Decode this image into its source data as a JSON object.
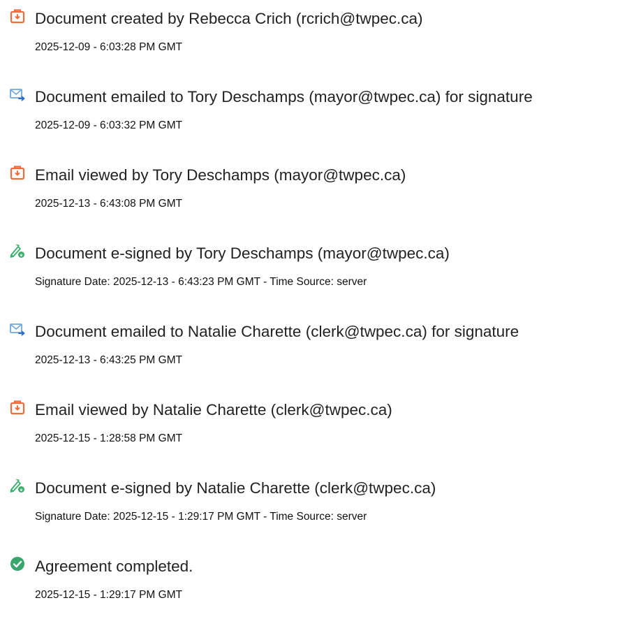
{
  "events": [
    {
      "icon": "document-created-icon",
      "title": "Document created by Rebecca Crich (rcrich@twpec.ca)",
      "detail": "2025-12-09 - 6:03:28 PM GMT"
    },
    {
      "icon": "email-sent-icon",
      "title": "Document emailed to Tory Deschamps (mayor@twpec.ca) for signature",
      "detail": "2025-12-09 - 6:03:32 PM GMT"
    },
    {
      "icon": "email-viewed-icon",
      "title": "Email viewed by Tory Deschamps (mayor@twpec.ca)",
      "detail": "2025-12-13 - 6:43:08 PM GMT"
    },
    {
      "icon": "esign-pen-icon",
      "title": "Document e-signed by Tory Deschamps (mayor@twpec.ca)",
      "detail": "Signature Date: 2025-12-13 - 6:43:23 PM GMT - Time Source: server"
    },
    {
      "icon": "email-sent-icon",
      "title": "Document emailed to Natalie Charette (clerk@twpec.ca) for signature",
      "detail": "2025-12-13 - 6:43:25 PM GMT"
    },
    {
      "icon": "email-viewed-icon",
      "title": "Email viewed by Natalie Charette (clerk@twpec.ca)",
      "detail": "2025-12-15 - 1:28:58 PM GMT"
    },
    {
      "icon": "esign-pen-icon",
      "title": "Document e-signed by Natalie Charette (clerk@twpec.ca)",
      "detail": "Signature Date: 2025-12-15 - 1:29:17 PM GMT - Time Source: server"
    },
    {
      "icon": "checkmark-circle-icon",
      "title": "Agreement completed.",
      "detail": "2025-12-15 - 1:29:17 PM GMT"
    }
  ],
  "colors": {
    "document_icon": "#F26B3A",
    "email_icon": "#6FA8DC",
    "pen_icon": "#3BAE6E",
    "check_icon": "#37A66C",
    "text": "#222222"
  }
}
